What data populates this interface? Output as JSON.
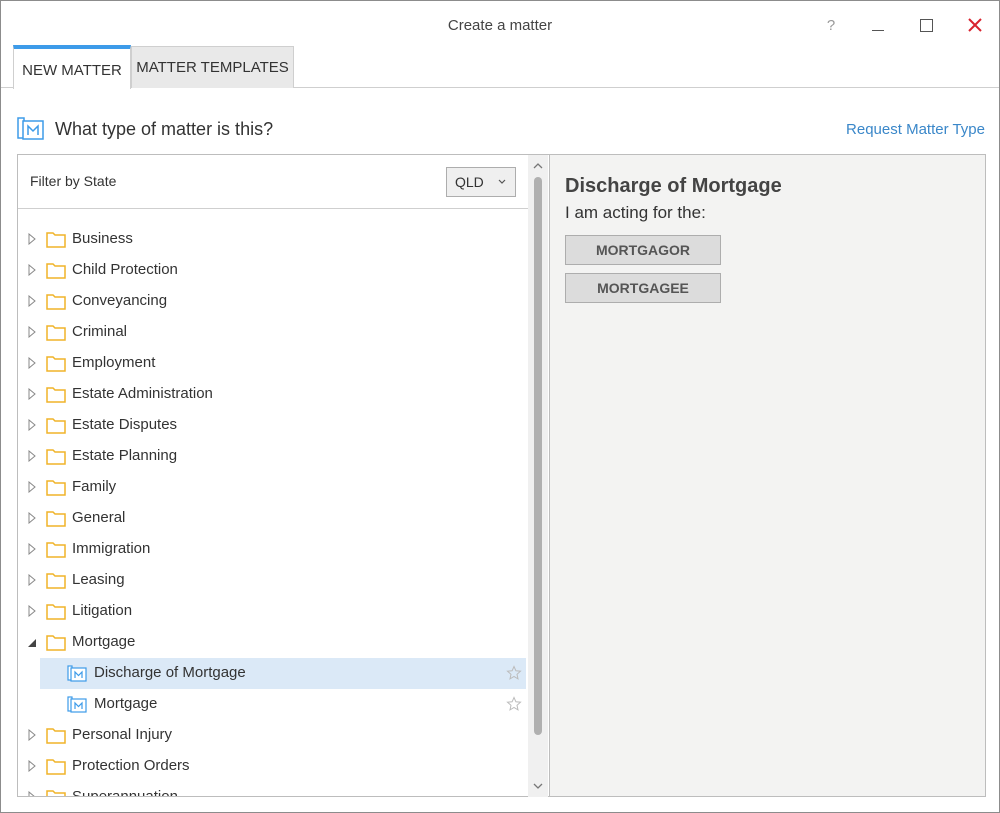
{
  "window": {
    "title": "Create a matter",
    "help_label": "?"
  },
  "tabs": [
    {
      "label": "NEW MATTER",
      "active": true
    },
    {
      "label": "MATTER TEMPLATES",
      "active": false
    }
  ],
  "header": {
    "question": "What type of matter is this?",
    "request_link": "Request Matter Type"
  },
  "filter": {
    "label": "Filter by State",
    "selected_state": "QLD"
  },
  "tree": {
    "items": [
      {
        "label": "Business"
      },
      {
        "label": "Child Protection"
      },
      {
        "label": "Conveyancing"
      },
      {
        "label": "Criminal"
      },
      {
        "label": "Employment"
      },
      {
        "label": "Estate Administration"
      },
      {
        "label": "Estate Disputes"
      },
      {
        "label": "Estate Planning"
      },
      {
        "label": "Family"
      },
      {
        "label": "General"
      },
      {
        "label": "Immigration"
      },
      {
        "label": "Leasing"
      },
      {
        "label": "Litigation"
      },
      {
        "label": "Mortgage",
        "expanded": true
      },
      {
        "label": "Discharge of Mortgage",
        "child": true,
        "selected": true
      },
      {
        "label": "Mortgage",
        "child": true
      },
      {
        "label": "Personal Injury"
      },
      {
        "label": "Protection Orders"
      },
      {
        "label": "Superannuation"
      }
    ]
  },
  "detail": {
    "title": "Discharge of Mortgage",
    "subtitle": "I am acting for the:",
    "roles": [
      "MORTGAGOR",
      "MORTGAGEE"
    ]
  },
  "colors": {
    "accent": "#3d9be9",
    "link": "#3a87c9",
    "folder": "#f0b429",
    "close": "#d9232e",
    "selection": "#dbe9f7"
  }
}
